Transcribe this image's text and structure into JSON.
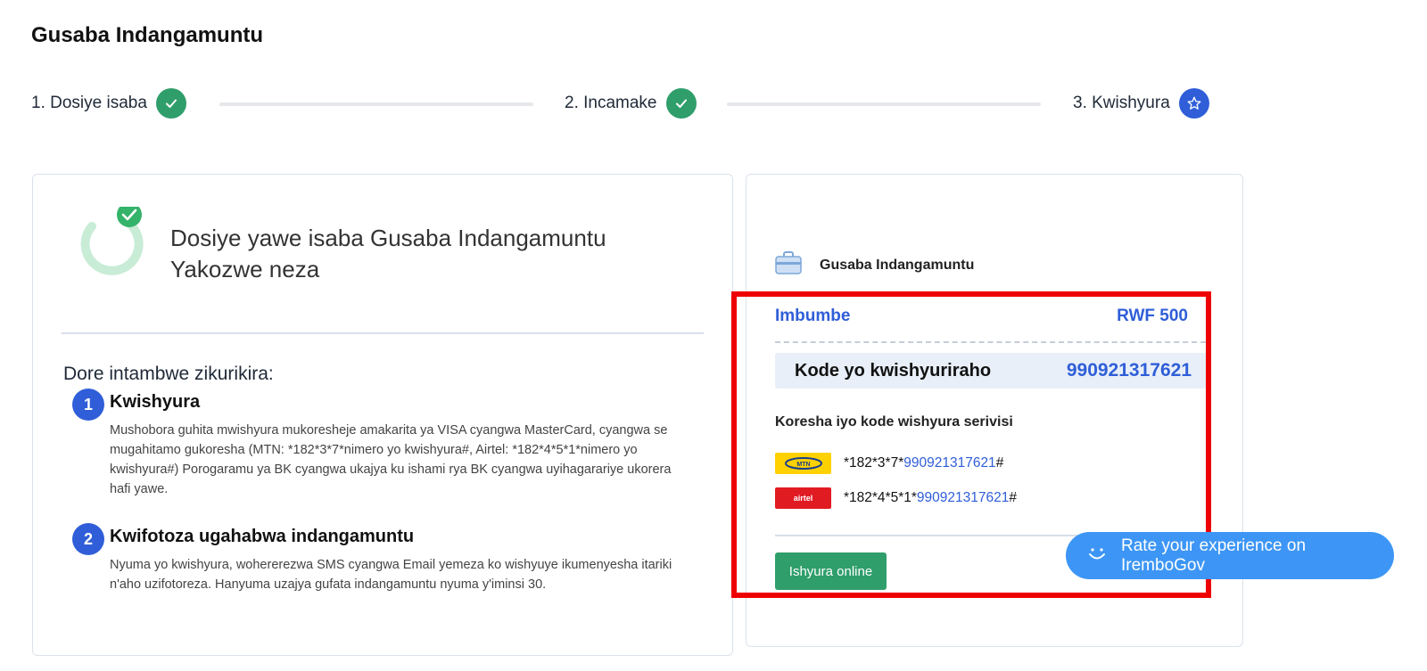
{
  "page": {
    "title": "Gusaba Indangamuntu"
  },
  "stepper": {
    "steps": [
      {
        "label": "1. Dosiye isaba",
        "status": "done"
      },
      {
        "label": "2. Incamake",
        "status": "done"
      },
      {
        "label": "3. Kwishyura",
        "status": "current"
      }
    ]
  },
  "summary": {
    "success_title_line1": "Dosiye yawe isaba Gusaba Indangamuntu",
    "success_title_line2": "Yakozwe neza",
    "next_steps_heading": "Dore intambwe zikurikira:",
    "steps": [
      {
        "number": "1",
        "title": "Kwishyura",
        "description": "Mushobora guhita mwishyura mukoresheje amakarita ya VISA cyangwa MasterCard, cyangwa se mugahitamo gukoresha (MTN: *182*3*7*nimero yo kwishyura#, Airtel: *182*4*5*1*nimero yo kwishyura#) Porogaramu ya BK cyangwa ukajya ku ishami rya BK cyangwa uyihagarariye ukorera hafi yawe."
      },
      {
        "number": "2",
        "title": "Kwifotoza ugahabwa indangamuntu",
        "description": "Nyuma yo kwishyura, wohererezwa SMS cyangwa Email yemeza ko wishyuye ikumenyesha itariki n'aho uzifotoreza. Hanyuma uzajya gufata indangamuntu nyuma y'iminsi 30."
      }
    ]
  },
  "payment": {
    "service_name": "Gusaba Indangamuntu",
    "amount_label": "Imbumbe",
    "amount_value": "RWF 500",
    "code_label": "Kode yo kwishyuriraho",
    "code_value": "990921317621",
    "instruction": "Koresha iyo kode wishyura serivisi",
    "ussd": [
      {
        "provider": "mtn",
        "logo_text": "MTN",
        "prefix": "*182*3*7*",
        "code": "990921317621",
        "suffix": "#"
      },
      {
        "provider": "airtel",
        "logo_text": "airtel",
        "prefix": "*182*4*5*1*",
        "code": "990921317621",
        "suffix": "#"
      }
    ],
    "pay_online_label": "Ishyura online"
  },
  "feedback": {
    "label": "Rate your experience on IremboGov"
  },
  "colors": {
    "primary": "#2f5ed8",
    "success": "#2f9e6b",
    "highlight": "#ee0000",
    "feedback": "#3d96f5"
  }
}
